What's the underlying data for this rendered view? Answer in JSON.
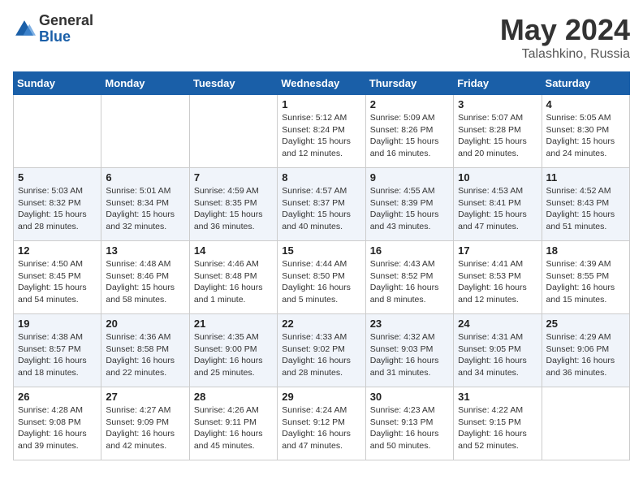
{
  "header": {
    "logo_general": "General",
    "logo_blue": "Blue",
    "title": "May 2024",
    "location": "Talashkino, Russia"
  },
  "weekdays": [
    "Sunday",
    "Monday",
    "Tuesday",
    "Wednesday",
    "Thursday",
    "Friday",
    "Saturday"
  ],
  "weeks": [
    [
      {
        "day": "",
        "info": ""
      },
      {
        "day": "",
        "info": ""
      },
      {
        "day": "",
        "info": ""
      },
      {
        "day": "1",
        "info": "Sunrise: 5:12 AM\nSunset: 8:24 PM\nDaylight: 15 hours\nand 12 minutes."
      },
      {
        "day": "2",
        "info": "Sunrise: 5:09 AM\nSunset: 8:26 PM\nDaylight: 15 hours\nand 16 minutes."
      },
      {
        "day": "3",
        "info": "Sunrise: 5:07 AM\nSunset: 8:28 PM\nDaylight: 15 hours\nand 20 minutes."
      },
      {
        "day": "4",
        "info": "Sunrise: 5:05 AM\nSunset: 8:30 PM\nDaylight: 15 hours\nand 24 minutes."
      }
    ],
    [
      {
        "day": "5",
        "info": "Sunrise: 5:03 AM\nSunset: 8:32 PM\nDaylight: 15 hours\nand 28 minutes."
      },
      {
        "day": "6",
        "info": "Sunrise: 5:01 AM\nSunset: 8:34 PM\nDaylight: 15 hours\nand 32 minutes."
      },
      {
        "day": "7",
        "info": "Sunrise: 4:59 AM\nSunset: 8:35 PM\nDaylight: 15 hours\nand 36 minutes."
      },
      {
        "day": "8",
        "info": "Sunrise: 4:57 AM\nSunset: 8:37 PM\nDaylight: 15 hours\nand 40 minutes."
      },
      {
        "day": "9",
        "info": "Sunrise: 4:55 AM\nSunset: 8:39 PM\nDaylight: 15 hours\nand 43 minutes."
      },
      {
        "day": "10",
        "info": "Sunrise: 4:53 AM\nSunset: 8:41 PM\nDaylight: 15 hours\nand 47 minutes."
      },
      {
        "day": "11",
        "info": "Sunrise: 4:52 AM\nSunset: 8:43 PM\nDaylight: 15 hours\nand 51 minutes."
      }
    ],
    [
      {
        "day": "12",
        "info": "Sunrise: 4:50 AM\nSunset: 8:45 PM\nDaylight: 15 hours\nand 54 minutes."
      },
      {
        "day": "13",
        "info": "Sunrise: 4:48 AM\nSunset: 8:46 PM\nDaylight: 15 hours\nand 58 minutes."
      },
      {
        "day": "14",
        "info": "Sunrise: 4:46 AM\nSunset: 8:48 PM\nDaylight: 16 hours\nand 1 minute."
      },
      {
        "day": "15",
        "info": "Sunrise: 4:44 AM\nSunset: 8:50 PM\nDaylight: 16 hours\nand 5 minutes."
      },
      {
        "day": "16",
        "info": "Sunrise: 4:43 AM\nSunset: 8:52 PM\nDaylight: 16 hours\nand 8 minutes."
      },
      {
        "day": "17",
        "info": "Sunrise: 4:41 AM\nSunset: 8:53 PM\nDaylight: 16 hours\nand 12 minutes."
      },
      {
        "day": "18",
        "info": "Sunrise: 4:39 AM\nSunset: 8:55 PM\nDaylight: 16 hours\nand 15 minutes."
      }
    ],
    [
      {
        "day": "19",
        "info": "Sunrise: 4:38 AM\nSunset: 8:57 PM\nDaylight: 16 hours\nand 18 minutes."
      },
      {
        "day": "20",
        "info": "Sunrise: 4:36 AM\nSunset: 8:58 PM\nDaylight: 16 hours\nand 22 minutes."
      },
      {
        "day": "21",
        "info": "Sunrise: 4:35 AM\nSunset: 9:00 PM\nDaylight: 16 hours\nand 25 minutes."
      },
      {
        "day": "22",
        "info": "Sunrise: 4:33 AM\nSunset: 9:02 PM\nDaylight: 16 hours\nand 28 minutes."
      },
      {
        "day": "23",
        "info": "Sunrise: 4:32 AM\nSunset: 9:03 PM\nDaylight: 16 hours\nand 31 minutes."
      },
      {
        "day": "24",
        "info": "Sunrise: 4:31 AM\nSunset: 9:05 PM\nDaylight: 16 hours\nand 34 minutes."
      },
      {
        "day": "25",
        "info": "Sunrise: 4:29 AM\nSunset: 9:06 PM\nDaylight: 16 hours\nand 36 minutes."
      }
    ],
    [
      {
        "day": "26",
        "info": "Sunrise: 4:28 AM\nSunset: 9:08 PM\nDaylight: 16 hours\nand 39 minutes."
      },
      {
        "day": "27",
        "info": "Sunrise: 4:27 AM\nSunset: 9:09 PM\nDaylight: 16 hours\nand 42 minutes."
      },
      {
        "day": "28",
        "info": "Sunrise: 4:26 AM\nSunset: 9:11 PM\nDaylight: 16 hours\nand 45 minutes."
      },
      {
        "day": "29",
        "info": "Sunrise: 4:24 AM\nSunset: 9:12 PM\nDaylight: 16 hours\nand 47 minutes."
      },
      {
        "day": "30",
        "info": "Sunrise: 4:23 AM\nSunset: 9:13 PM\nDaylight: 16 hours\nand 50 minutes."
      },
      {
        "day": "31",
        "info": "Sunrise: 4:22 AM\nSunset: 9:15 PM\nDaylight: 16 hours\nand 52 minutes."
      },
      {
        "day": "",
        "info": ""
      }
    ]
  ]
}
